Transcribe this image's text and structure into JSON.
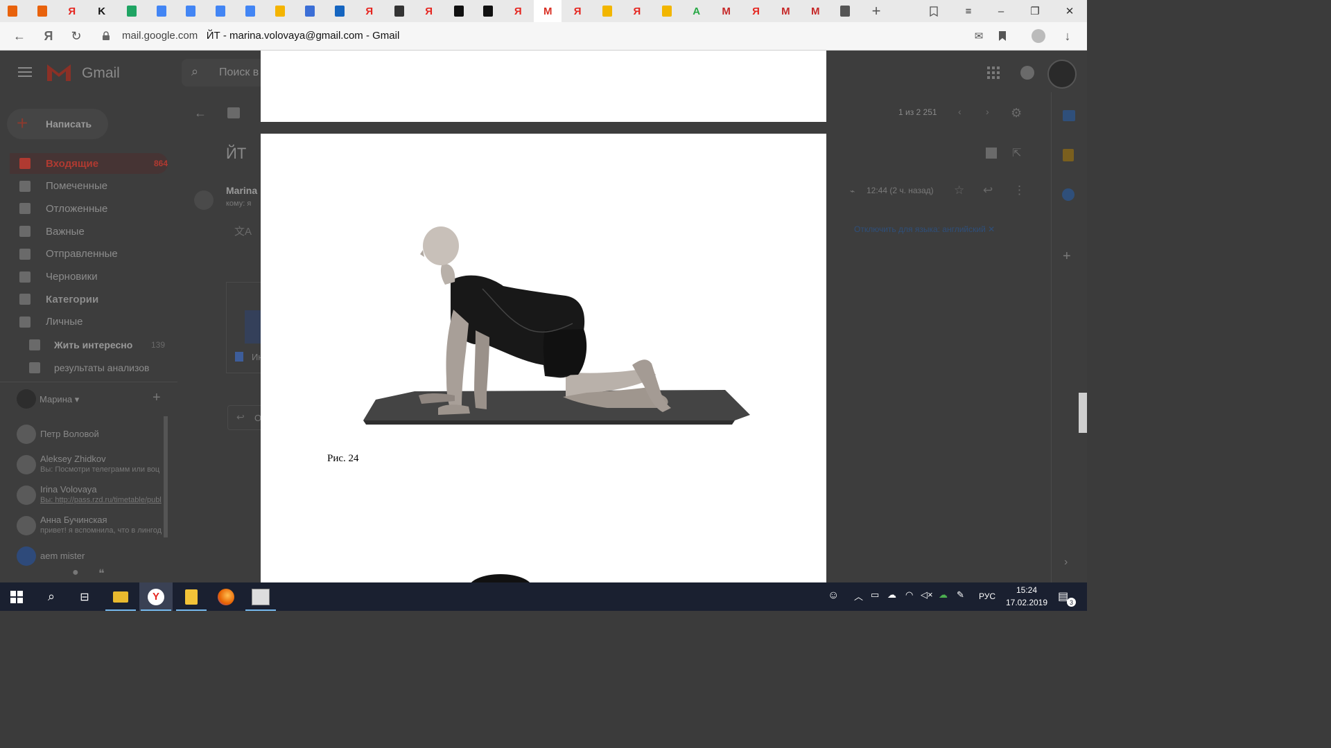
{
  "browser": {
    "tabs": [
      {
        "icon": "pencil-flame-icon",
        "color": "#e8620c"
      },
      {
        "icon": "pencil-flame-icon",
        "color": "#e8620c"
      },
      {
        "icon": "yandex-icon",
        "color": "#e52620",
        "glyph": "Я"
      },
      {
        "icon": "k-logo-icon",
        "color": "#111111",
        "glyph": "K"
      },
      {
        "icon": "google-drive-icon",
        "color": "#1fa463"
      },
      {
        "icon": "google-docs-icon",
        "color": "#4285f4"
      },
      {
        "icon": "google-docs-icon",
        "color": "#4285f4"
      },
      {
        "icon": "google-docs-icon",
        "color": "#4285f4"
      },
      {
        "icon": "google-docs-icon",
        "color": "#4285f4"
      },
      {
        "icon": "pinwheel-icon",
        "color": "#f4b400"
      },
      {
        "icon": "google-docs-icon",
        "color": "#3b6ed6"
      },
      {
        "icon": "swirl-icon",
        "color": "#1565c0"
      },
      {
        "icon": "yandex-icon",
        "color": "#e52620",
        "glyph": "Я"
      },
      {
        "icon": "owl-icon",
        "color": "#333333"
      },
      {
        "icon": "yandex-icon",
        "color": "#e52620",
        "glyph": "Я"
      },
      {
        "icon": "dark-square-icon",
        "color": "#111111"
      },
      {
        "icon": "dark-square-icon",
        "color": "#111111"
      },
      {
        "icon": "yandex-icon",
        "color": "#e52620",
        "glyph": "Я"
      },
      {
        "icon": "gmail-icon",
        "color": "#d93025",
        "glyph": "M",
        "active": true
      },
      {
        "icon": "yandex-icon",
        "color": "#e52620",
        "glyph": "Я"
      },
      {
        "icon": "photo-icon",
        "color": "#f2b600"
      },
      {
        "icon": "yandex-icon",
        "color": "#e52620",
        "glyph": "Я"
      },
      {
        "icon": "photo-icon",
        "color": "#f2b600"
      },
      {
        "icon": "green-a-icon",
        "color": "#27a844",
        "glyph": "A"
      },
      {
        "icon": "m-badge-icon",
        "color": "#c62828",
        "glyph": "M"
      },
      {
        "icon": "yandex-icon",
        "color": "#e52620",
        "glyph": "Я"
      },
      {
        "icon": "m-badge-icon",
        "color": "#c62828",
        "glyph": "M"
      },
      {
        "icon": "m-badge-icon",
        "color": "#c62828",
        "glyph": "M"
      },
      {
        "icon": "blank-page-icon",
        "color": "#555555"
      }
    ],
    "address_host": "mail.google.com",
    "page_title": "ЙТ - marina.volovaya@gmail.com - Gmail"
  },
  "gmail": {
    "brand": "Gmail",
    "search_placeholder": "Поиск в",
    "compose": "Написать",
    "folders": [
      {
        "label": "Входящие",
        "count": "864",
        "bold": true,
        "color": "#b03a31"
      },
      {
        "label": "Помеченные",
        "count": ""
      },
      {
        "label": "Отложенные",
        "count": ""
      },
      {
        "label": "Важные",
        "count": ""
      },
      {
        "label": "Отправленные",
        "count": ""
      },
      {
        "label": "Черновики",
        "count": ""
      },
      {
        "label": "Категории",
        "count": "",
        "bold": true
      },
      {
        "label": "Личные",
        "count": ""
      }
    ],
    "sublabels": [
      {
        "label": "Жить интересно",
        "count": "139",
        "bold": true
      },
      {
        "label": "результаты анализов",
        "count": ""
      }
    ],
    "hangouts_user": "Марина",
    "chats": [
      {
        "name": "Петр Воловой",
        "preview": ""
      },
      {
        "name": "Aleksey Zhidkov",
        "preview": "Вы: Посмотри телеграмм или воц"
      },
      {
        "name": "Irina Volovaya",
        "preview": "Вы: http://pass.rzd.ru/timetable/publ"
      },
      {
        "name": "Анна Бучинская",
        "preview": "привет! я вспомнила, что в лингод"
      },
      {
        "name": "aem mister",
        "preview": ""
      }
    ],
    "pagination": "1 из 2 251",
    "subject": "ЙТ",
    "sender": "Marina",
    "to_line": "кому: я",
    "time": "12:44 (2 ч. назад)",
    "translate_off": "Отключить для языка: английский",
    "attachment_snippet": "Ин",
    "reply_snippet": "О"
  },
  "viewer": {
    "caption": "Рис. 24"
  },
  "taskbar": {
    "lang": "РУС",
    "time": "15:24",
    "date": "17.02.2019",
    "notifications": "3"
  }
}
